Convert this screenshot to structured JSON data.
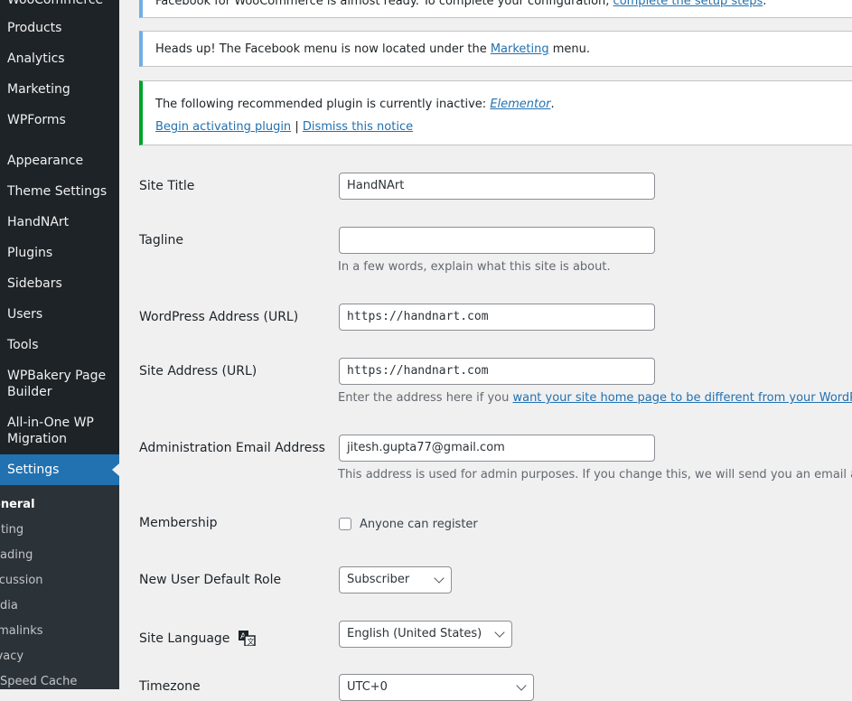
{
  "sidebar": {
    "partial_top_item": "WooCommerce",
    "items": [
      "Products",
      "Analytics",
      "Marketing",
      "WPForms",
      "Appearance",
      "Theme Settings",
      "HandNArt",
      "Plugins",
      "Sidebars",
      "Users",
      "Tools",
      "WPBakery Page Builder",
      "All-in-One WP Migration"
    ],
    "current": "Settings",
    "submenu": [
      "eneral",
      "riting",
      "eading",
      "scussion",
      "edia",
      "rmalinks",
      "ivacy",
      "eSpeed Cache"
    ]
  },
  "notices": {
    "woo": {
      "text": "Facebook for WooCommerce is almost ready. To complete your configuration, ",
      "link": "complete the setup steps",
      "end": "."
    },
    "facebook": {
      "text": "Heads up! The Facebook menu is now located under the ",
      "link": "Marketing",
      "end": " menu."
    },
    "plugin": {
      "text": "The following recommended plugin is currently inactive: ",
      "link": "Elementor",
      "end": ".",
      "activate": "Begin activating plugin",
      "sep": "|",
      "dismiss": "Dismiss this notice"
    }
  },
  "form": {
    "site_title": {
      "label": "Site Title",
      "value": "HandNArt"
    },
    "tagline": {
      "label": "Tagline",
      "value": "",
      "desc": "In a few words, explain what this site is about."
    },
    "wp_address": {
      "label": "WordPress Address (URL)",
      "value": "https://handnart.com"
    },
    "site_address": {
      "label": "Site Address (URL)",
      "value": "https://handnart.com",
      "desc": "Enter the address here if you ",
      "desc_link": "want your site home page to be different from your WordPress"
    },
    "admin_email": {
      "label": "Administration Email Address",
      "value": "jitesh.gupta77@gmail.com",
      "desc": "This address is used for admin purposes. If you change this, we will send you an email at you"
    },
    "membership": {
      "label": "Membership",
      "checkbox_label": "Anyone can register"
    },
    "default_role": {
      "label": "New User Default Role",
      "value": "Subscriber"
    },
    "language": {
      "label": "Site Language",
      "value": "English (United States)"
    },
    "timezone": {
      "label": "Timezone",
      "value": "UTC+0"
    }
  }
}
